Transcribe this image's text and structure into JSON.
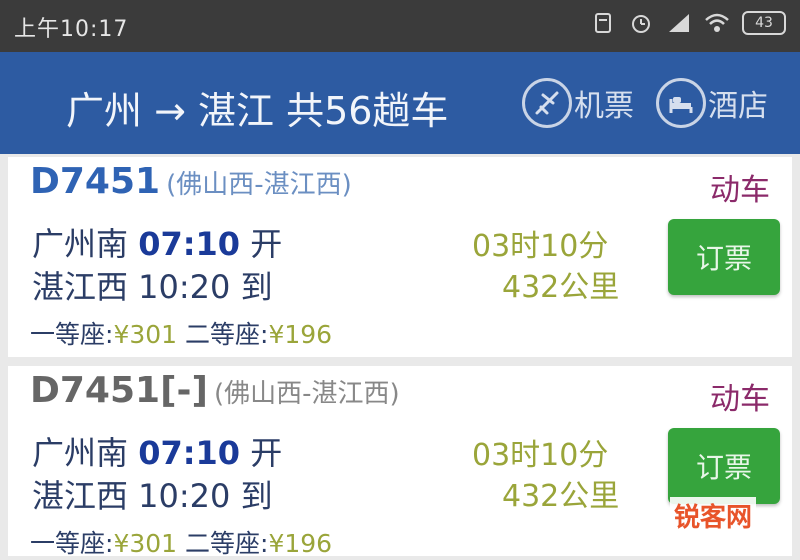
{
  "status_bar": {
    "time": "上午10:17",
    "battery": "43"
  },
  "header": {
    "route_title": "广州 → 湛江 共56趟车",
    "flight_label": "机票",
    "hotel_label": "酒店",
    "bg_color": "#2d5ba2"
  },
  "trains": [
    {
      "number": "D7451",
      "range": "(佛山西-湛江西)",
      "type": "动车",
      "depart_station": "广州南",
      "depart_time": "07:10",
      "depart_suffix": "开",
      "arrive": "湛江西 10:20 到",
      "duration": "03时10分",
      "distance": "432公里",
      "book_label": "订票",
      "first_class_label": "一等座:",
      "first_class_price": "¥301",
      "second_class_label": "二等座:",
      "second_class_price": "¥196"
    },
    {
      "number": "D7451[-]",
      "range": "(佛山西-湛江西)",
      "type": "动车",
      "depart_station": "广州南",
      "depart_time": "07:10",
      "depart_suffix": "开",
      "arrive": "湛江西 10:20 到",
      "duration": "03时10分",
      "distance": "432公里",
      "book_label": "订票",
      "first_class_label": "一等座:",
      "first_class_price": "¥301",
      "second_class_label": "二等座:",
      "second_class_price": "¥196"
    }
  ],
  "watermark": "锐客网",
  "colors": {
    "book_button": "#36a43d",
    "train_type": "#8b2a6a",
    "accent_green": "#9aa53a"
  }
}
